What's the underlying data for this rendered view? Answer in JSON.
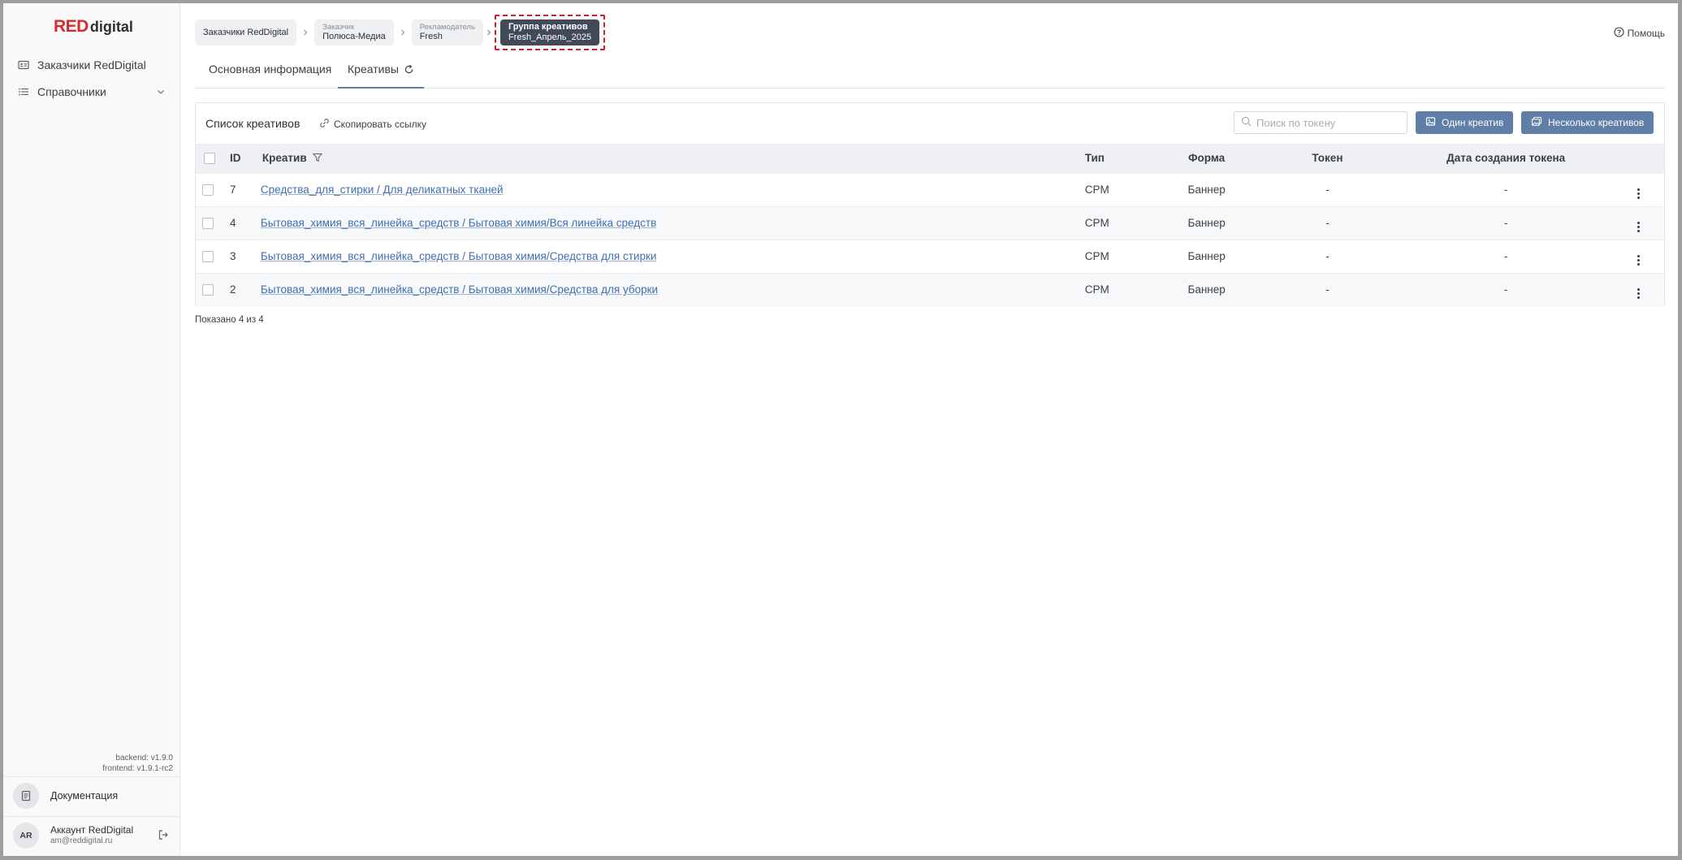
{
  "logo": {
    "red": "RED",
    "digital": "digital"
  },
  "sidebar": {
    "items": [
      {
        "label": "Заказчики RedDigital",
        "icon": "id-card-icon"
      },
      {
        "label": "Справочники",
        "icon": "list-icon",
        "expandable": true
      }
    ],
    "version_backend": "backend: v1.9.0",
    "version_frontend": "frontend: v1.9.1-rc2",
    "docs_label": "Документация",
    "account": {
      "initials": "AR",
      "name": "Аккаунт RedDigital",
      "email": "am@reddigital.ru"
    }
  },
  "breadcrumbs": [
    {
      "caption": "",
      "value": "Заказчики RedDigital"
    },
    {
      "caption": "Заказчик",
      "value": "Полюса-Медиа"
    },
    {
      "caption": "Рекламодатель",
      "value": "Fresh"
    },
    {
      "caption": "Группа креативов",
      "value": "Fresh_Апрель_2025",
      "active": true
    }
  ],
  "help_label": "Помощь",
  "tabs": [
    {
      "label": "Основная информация",
      "active": false
    },
    {
      "label": "Креативы",
      "active": true
    }
  ],
  "card": {
    "title": "Список креативов",
    "copy_link": "Скопировать ссылку",
    "search_placeholder": "Поиск по токену",
    "btn_one": "Один креатив",
    "btn_many": "Несколько креативов"
  },
  "table": {
    "headers": {
      "id": "ID",
      "creative": "Креатив",
      "type": "Тип",
      "form": "Форма",
      "token": "Токен",
      "token_date": "Дата создания токена"
    },
    "rows": [
      {
        "id": "7",
        "creative": "Средства_для_стирки / Для деликатных тканей",
        "type": "CPM",
        "form": "Баннер",
        "token": "-",
        "token_date": "-"
      },
      {
        "id": "4",
        "creative": "Бытовая_химия_вся_линейка_средств / Бытовая химия/Вся линейка средств",
        "type": "CPM",
        "form": "Баннер",
        "token": "-",
        "token_date": "-"
      },
      {
        "id": "3",
        "creative": "Бытовая_химия_вся_линейка_средств / Бытовая химия/Средства для стирки",
        "type": "CPM",
        "form": "Баннер",
        "token": "-",
        "token_date": "-"
      },
      {
        "id": "2",
        "creative": "Бытовая_химия_вся_линейка_средств / Бытовая химия/Средства для уборки",
        "type": "CPM",
        "form": "Баннер",
        "token": "-",
        "token_date": "-"
      }
    ]
  },
  "shown_text": "Показано 4 из 4",
  "colors": {
    "brand_red": "#d82c2c",
    "button": "#5f7fa8",
    "active_crumb": "#424a5a",
    "highlight": "#c8212b",
    "link": "#3f6fb3"
  }
}
